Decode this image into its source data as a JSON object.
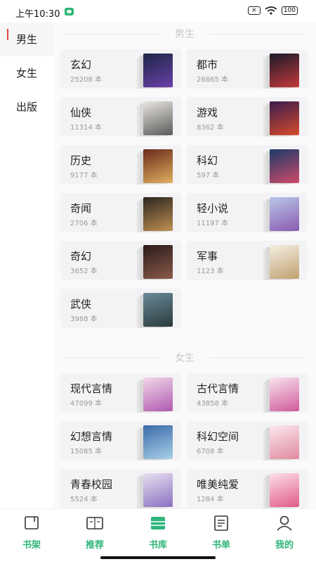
{
  "status_bar": {
    "time": "上午10:30",
    "battery": "100"
  },
  "sidebar": {
    "items": [
      {
        "label": "男生",
        "active": true
      },
      {
        "label": "女生",
        "active": false
      },
      {
        "label": "出版",
        "active": false
      }
    ]
  },
  "sections": [
    {
      "title": "男生",
      "categories": [
        {
          "name": "玄幻",
          "count": "25208 本",
          "cover_colors": [
            "#1e2748",
            "#6a3fa8"
          ]
        },
        {
          "name": "都市",
          "count": "26865 本",
          "cover_colors": [
            "#1a1a2a",
            "#c43a3a"
          ]
        },
        {
          "name": "仙侠",
          "count": "11314 本",
          "cover_colors": [
            "#e9e6e0",
            "#5a5a5a"
          ]
        },
        {
          "name": "游戏",
          "count": "8362 本",
          "cover_colors": [
            "#3a1d4e",
            "#d84a2a"
          ]
        },
        {
          "name": "历史",
          "count": "9177 本",
          "cover_colors": [
            "#6a2a1a",
            "#e0b060"
          ]
        },
        {
          "name": "科幻",
          "count": "597 本",
          "cover_colors": [
            "#1a3a6a",
            "#d04a6a"
          ]
        },
        {
          "name": "奇闻",
          "count": "2706 本",
          "cover_colors": [
            "#2a2520",
            "#c09050"
          ]
        },
        {
          "name": "轻小说",
          "count": "11197 本",
          "cover_colors": [
            "#b8c8e8",
            "#8a5ab0"
          ]
        },
        {
          "name": "奇幻",
          "count": "3652 本",
          "cover_colors": [
            "#2a1a1a",
            "#8a5a4a"
          ]
        },
        {
          "name": "军事",
          "count": "1123 本",
          "cover_colors": [
            "#f4efe2",
            "#c0a070"
          ]
        },
        {
          "name": "武侠",
          "count": "3988 本",
          "cover_colors": [
            "#6a8a9a",
            "#2a3a3a"
          ]
        }
      ]
    },
    {
      "title": "女生",
      "categories": [
        {
          "name": "现代言情",
          "count": "47099 本",
          "cover_colors": [
            "#f2d8e8",
            "#b05ab0"
          ]
        },
        {
          "name": "古代言情",
          "count": "43858 本",
          "cover_colors": [
            "#f8e4ee",
            "#d05a9a"
          ]
        },
        {
          "name": "幻想言情",
          "count": "15085 本",
          "cover_colors": [
            "#3a6aa8",
            "#a8d0e8"
          ]
        },
        {
          "name": "科幻空间",
          "count": "6708 本",
          "cover_colors": [
            "#fbe8ee",
            "#e08aa0"
          ]
        },
        {
          "name": "青春校园",
          "count": "5524 本",
          "cover_colors": [
            "#e8e0f0",
            "#8a70c0"
          ]
        },
        {
          "name": "唯美纯爱",
          "count": "1284 本",
          "cover_colors": [
            "#fde0e8",
            "#e05a8a"
          ]
        }
      ]
    }
  ],
  "bottom_nav": {
    "accent_color": "#2fb57a",
    "items": [
      {
        "label": "书架",
        "icon": "bookshelf-icon"
      },
      {
        "label": "推荐",
        "icon": "open-book-icon"
      },
      {
        "label": "书库",
        "icon": "library-icon"
      },
      {
        "label": "书单",
        "icon": "booklist-icon"
      },
      {
        "label": "我的",
        "icon": "profile-icon"
      }
    ]
  }
}
